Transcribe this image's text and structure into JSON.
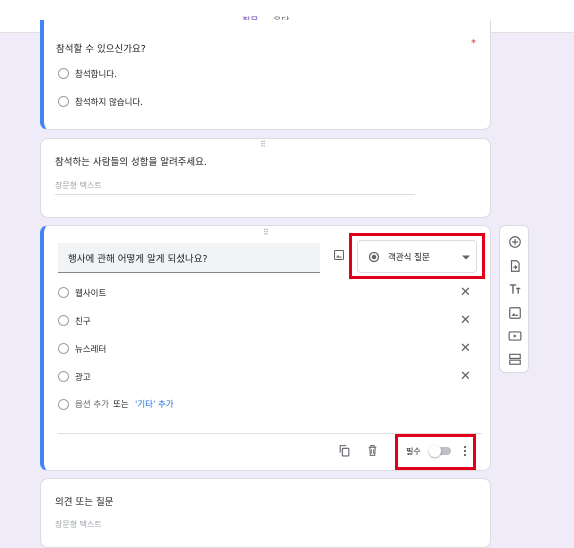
{
  "tabs": [
    {
      "label": "질문",
      "active": true
    },
    {
      "label": "응답",
      "active": false
    }
  ],
  "card1": {
    "title": "참석할 수 있으신가요?",
    "required_mark": "*",
    "options": [
      "참석합니다.",
      "참석하지 않습니다."
    ]
  },
  "card2": {
    "title": "참석하는 사람들의 성함을 알려주세요.",
    "placeholder": "장문형 텍스트"
  },
  "card3": {
    "question": "행사에 관해 어떻게 알게 되셨나요?",
    "type_label": "객관식 질문",
    "options": [
      "웹사이트",
      "친구",
      "뉴스레터",
      "광고"
    ],
    "add_option": "옵션 추가",
    "or_text": "또는",
    "add_other": "'기타' 추가",
    "required_label": "필수"
  },
  "card4": {
    "title": "의견 또는 질문",
    "placeholder": "장문형 텍스트"
  },
  "colors": {
    "accent": "#673ab7",
    "active_border": "#4285f4",
    "highlight_box": "#e0001b",
    "link": "#1a73e8"
  },
  "icons": [
    "add-circle-icon",
    "import-icon",
    "title-icon",
    "image-icon",
    "video-icon",
    "section-icon",
    "copy-icon",
    "trash-icon",
    "more-vert-icon",
    "close-icon",
    "drag-handle-icon",
    "dropdown-arrow-icon",
    "radio-icon"
  ]
}
